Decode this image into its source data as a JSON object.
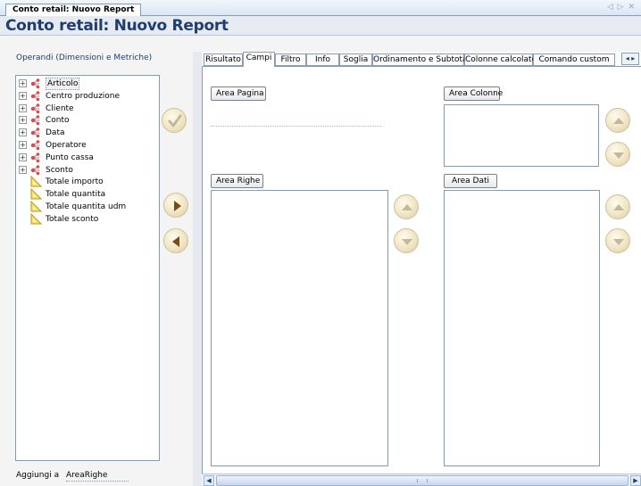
{
  "document_tab": {
    "title": "Conto retail: Nuovo Report"
  },
  "doc_nav": {
    "glyphs": "◁ ▷ ✕"
  },
  "header": {
    "title": "Conto retail: Nuovo Report"
  },
  "left_panel": {
    "title": "Operandi (Dimensioni e Metriche)",
    "tree": [
      {
        "label": "Articolo",
        "kind": "dimension",
        "selected": true
      },
      {
        "label": "Centro produzione",
        "kind": "dimension"
      },
      {
        "label": "Cliente",
        "kind": "dimension"
      },
      {
        "label": "Conto",
        "kind": "dimension"
      },
      {
        "label": "Data",
        "kind": "dimension"
      },
      {
        "label": "Operatore",
        "kind": "dimension"
      },
      {
        "label": "Punto cassa",
        "kind": "dimension"
      },
      {
        "label": "Sconto",
        "kind": "dimension"
      },
      {
        "label": "Totale importo",
        "kind": "metric"
      },
      {
        "label": "Totale quantita",
        "kind": "metric"
      },
      {
        "label": "Totale quantita udm",
        "kind": "metric"
      },
      {
        "label": "Totale sconto",
        "kind": "metric"
      }
    ],
    "add_to_label": "Aggiungi a",
    "add_to_value": "AreaRighe"
  },
  "tabs": [
    {
      "label": "Risultato"
    },
    {
      "label": "Campi",
      "active": true
    },
    {
      "label": "Filtro"
    },
    {
      "label": "Info"
    },
    {
      "label": "Soglia"
    },
    {
      "label": "Ordinamento e Subtotali"
    },
    {
      "label": "Colonne calcolate"
    },
    {
      "label": "Comando custom"
    }
  ],
  "tab_scroll": {
    "glyphs": "◂ ▸"
  },
  "areas": {
    "pagina": "Area Pagina",
    "colonne": "Area Colonne",
    "righe": "Area Righe",
    "dati": "Area Dati"
  },
  "colors": {
    "title": "#1f3e6e",
    "border": "#7f9db9",
    "button_face": "#f0e5c4",
    "button_glyph_active": "#7a4a10",
    "button_glyph_disabled": "#c3b79c"
  }
}
